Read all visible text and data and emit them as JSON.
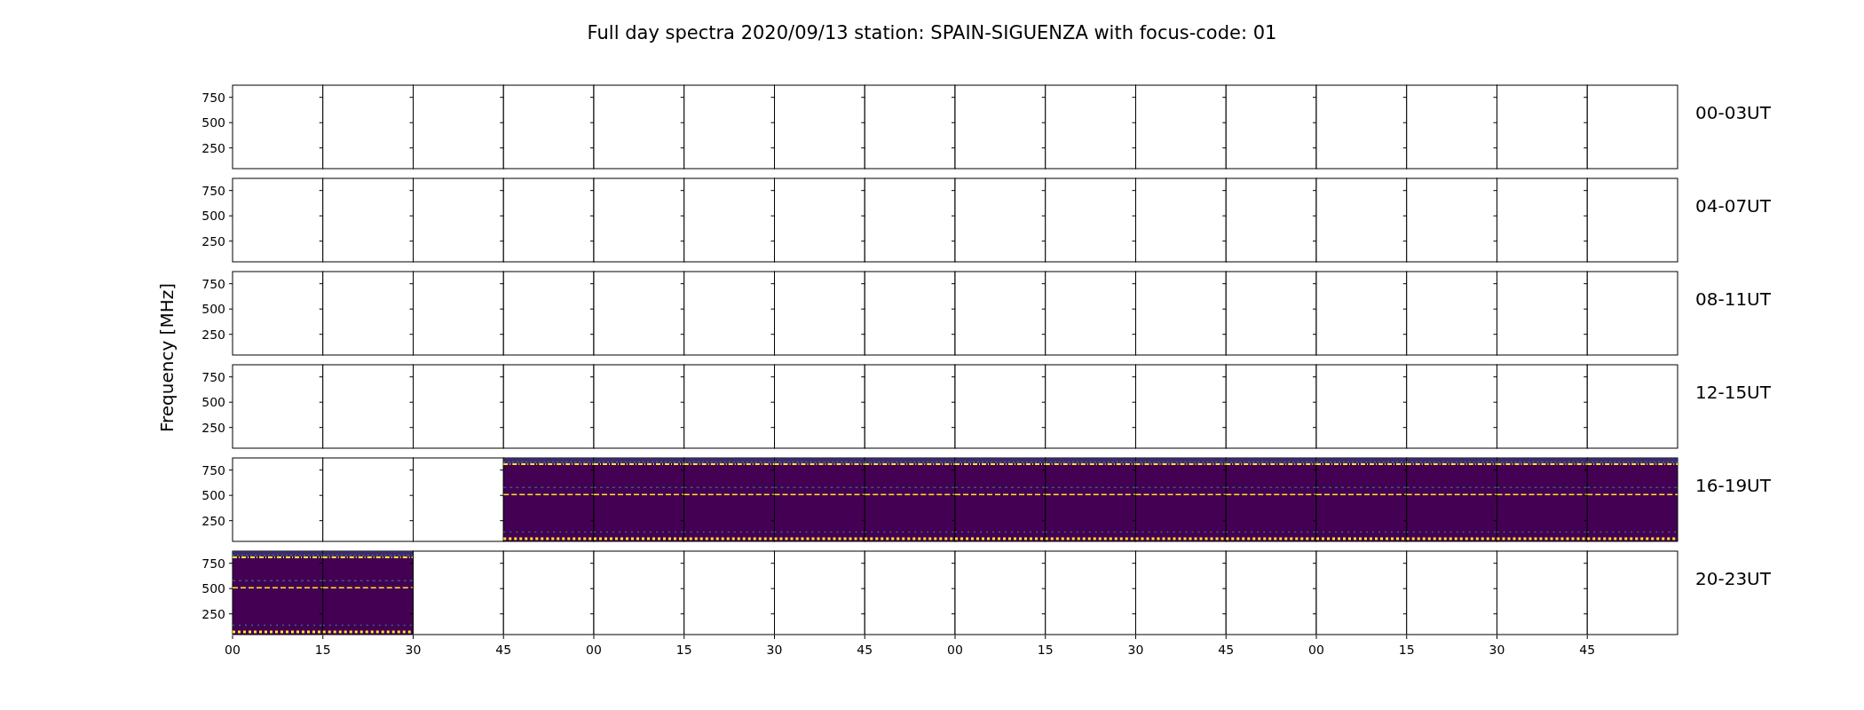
{
  "title": "Full day spectra 2020/09/13 station: SPAIN-SIGUENZA with focus-code: 01",
  "ylabel": "Frequency [MHz]",
  "xticks": [
    "00",
    "15",
    "30",
    "45",
    "00",
    "15",
    "30",
    "45",
    "00",
    "15",
    "30",
    "45",
    "00",
    "15",
    "30",
    "45"
  ],
  "rows": [
    {
      "label": "00-03UT",
      "yticks": [
        "750",
        "500",
        "250"
      ],
      "recorded": [
        false,
        false,
        false,
        false,
        false,
        false,
        false,
        false,
        false,
        false,
        false,
        false,
        false,
        false,
        false,
        false
      ]
    },
    {
      "label": "04-07UT",
      "yticks": [
        "750",
        "500",
        "250"
      ],
      "recorded": [
        false,
        false,
        false,
        false,
        false,
        false,
        false,
        false,
        false,
        false,
        false,
        false,
        false,
        false,
        false,
        false
      ]
    },
    {
      "label": "08-11UT",
      "yticks": [
        "750",
        "500",
        "250"
      ],
      "recorded": [
        false,
        false,
        false,
        false,
        false,
        false,
        false,
        false,
        false,
        false,
        false,
        false,
        false,
        false,
        false,
        false
      ]
    },
    {
      "label": "12-15UT",
      "yticks": [
        "750",
        "500",
        "250"
      ],
      "recorded": [
        false,
        false,
        false,
        false,
        false,
        false,
        false,
        false,
        false,
        false,
        false,
        false,
        false,
        false,
        false,
        false
      ]
    },
    {
      "label": "16-19UT",
      "yticks": [
        "750",
        "500",
        "250"
      ],
      "recorded": [
        false,
        false,
        false,
        true,
        true,
        true,
        true,
        true,
        true,
        true,
        true,
        true,
        true,
        true,
        true,
        true
      ]
    },
    {
      "label": "20-23UT",
      "yticks": [
        "750",
        "500",
        "250"
      ],
      "recorded": [
        true,
        true,
        false,
        false,
        false,
        false,
        false,
        false,
        false,
        false,
        false,
        false,
        false,
        false,
        false,
        false
      ]
    }
  ]
}
